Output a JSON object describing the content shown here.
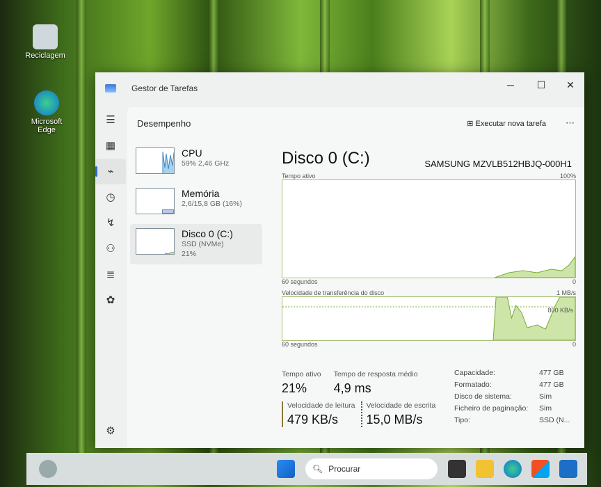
{
  "desktop": {
    "icons": [
      {
        "label": "Reciclagem"
      },
      {
        "label": "Microsoft Edge"
      }
    ]
  },
  "window": {
    "title": "Gestor de Tarefas",
    "minimize": "─",
    "maximize": "☐",
    "close": "✕"
  },
  "nav": {
    "icons": [
      "menu-icon",
      "processes-icon",
      "performance-icon",
      "app-history-icon",
      "startup-icon",
      "users-icon",
      "details-icon",
      "services-icon",
      "settings-icon"
    ]
  },
  "header": {
    "title": "Desempenho",
    "run_new_task": "Executar nova tarefa",
    "more": "⋯"
  },
  "resources": [
    {
      "name": "CPU",
      "line1": "59%  2,46 GHz",
      "line2": ""
    },
    {
      "name": "Memória",
      "line1": "2,6/15,8 GB (16%)",
      "line2": ""
    },
    {
      "name": "Disco 0 (C:)",
      "line1": "SSD (NVMe)",
      "line2": "21%"
    }
  ],
  "detail": {
    "title": "Disco 0 (C:)",
    "model": "SAMSUNG MZVLB512HBJQ-000H1",
    "graph1": {
      "label": "Tempo ativo",
      "max": "100%",
      "xlabel": "60 segundos",
      "min": "0"
    },
    "graph2": {
      "label": "Velocidade de transferência do disco",
      "max": "1 MB/s",
      "mid": "800 KB/s",
      "xlabel": "60 segundos",
      "min": "0"
    },
    "stats": {
      "active_label": "Tempo ativo",
      "active": "21%",
      "resp_label": "Tempo de resposta médio",
      "resp": "4,9 ms",
      "read_label": "Velocidade de leitura",
      "read": "479 KB/s",
      "write_label": "Velocidade de escrita",
      "write": "15,0 MB/s"
    },
    "props": [
      [
        "Capacidade:",
        "477 GB"
      ],
      [
        "Formatado:",
        "477 GB"
      ],
      [
        "Disco de sistema:",
        "Sim"
      ],
      [
        "Ficheiro de paginação:",
        "Sim"
      ],
      [
        "Tipo:",
        "SSD (N..."
      ]
    ]
  },
  "taskbar": {
    "search_placeholder": "Procurar"
  },
  "colors": {
    "accent": "#2b6cd3",
    "disk": "#8cc04a",
    "cpu": "#7fb8e0"
  }
}
